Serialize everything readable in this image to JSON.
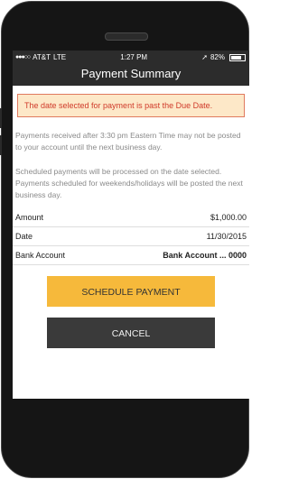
{
  "status_bar": {
    "carrier": "AT&T",
    "network": "LTE",
    "time": "1:27 PM",
    "battery": "82%",
    "signal_dots": "●●●○○",
    "location_icon": "location-arrow-icon"
  },
  "header": {
    "title": "Payment Summary"
  },
  "alert": {
    "message": "The date selected for payment is past the Due Date."
  },
  "notices": [
    "Payments received after 3:30 pm Eastern Time may not be posted to your account until the next business day.",
    "Scheduled payments will be processed on the date selected. Payments scheduled for weekends/holidays will be posted the next business day."
  ],
  "summary": {
    "amount_label": "Amount",
    "amount_value": "$1,000.00",
    "date_label": "Date",
    "date_value": "11/30/2015",
    "bank_label": "Bank Account",
    "bank_value": "Bank Account",
    "bank_suffix": "... 0000"
  },
  "buttons": {
    "schedule": "SCHEDULE PAYMENT",
    "cancel": "CANCEL"
  },
  "colors": {
    "accent": "#f6b93b",
    "alert_bg": "#fde8c8",
    "alert_text": "#d03a2a",
    "header_bg": "#2c2c2c"
  }
}
